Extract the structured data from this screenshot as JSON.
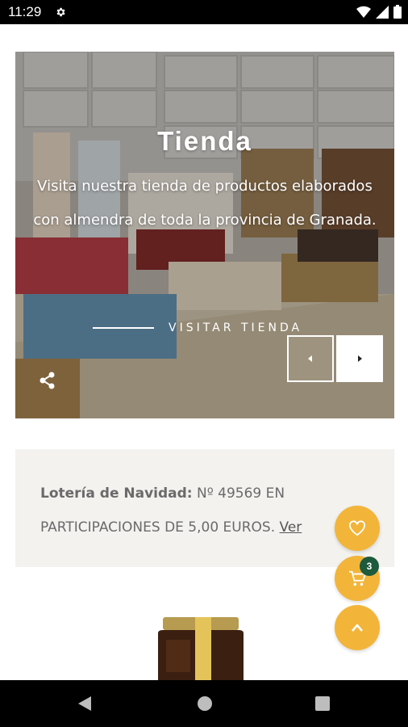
{
  "status_bar": {
    "time": "11:29",
    "icons": [
      "gear-icon",
      "wifi-icon",
      "signal-icon",
      "battery-icon"
    ]
  },
  "hero": {
    "title": "Tienda",
    "description": "Visita nuestra tienda de productos elaborados con almendra de toda la provincia de Granada.",
    "link_label": "VISITAR TIENDA",
    "prev_icon": "chevron-left-icon",
    "next_icon": "chevron-right-icon",
    "share_icon": "share-icon"
  },
  "lottery": {
    "label": "Lotería de Navidad:",
    "text": " Nº 49569 EN PARTICIPACIONES DE 5,00 EUROS. ",
    "link": "Ver"
  },
  "fabs": {
    "wishlist_icon": "heart-icon",
    "cart_icon": "cart-icon",
    "cart_count": "3",
    "scroll_top_icon": "chevron-up-icon"
  },
  "colors": {
    "accent": "#f2b53a",
    "badge": "#1e5a3c",
    "lottery_bg": "#f3f2ef",
    "text_muted": "#6a6a6a"
  },
  "nav_bar": {
    "icons": [
      "back-icon",
      "home-icon",
      "recents-icon"
    ]
  }
}
